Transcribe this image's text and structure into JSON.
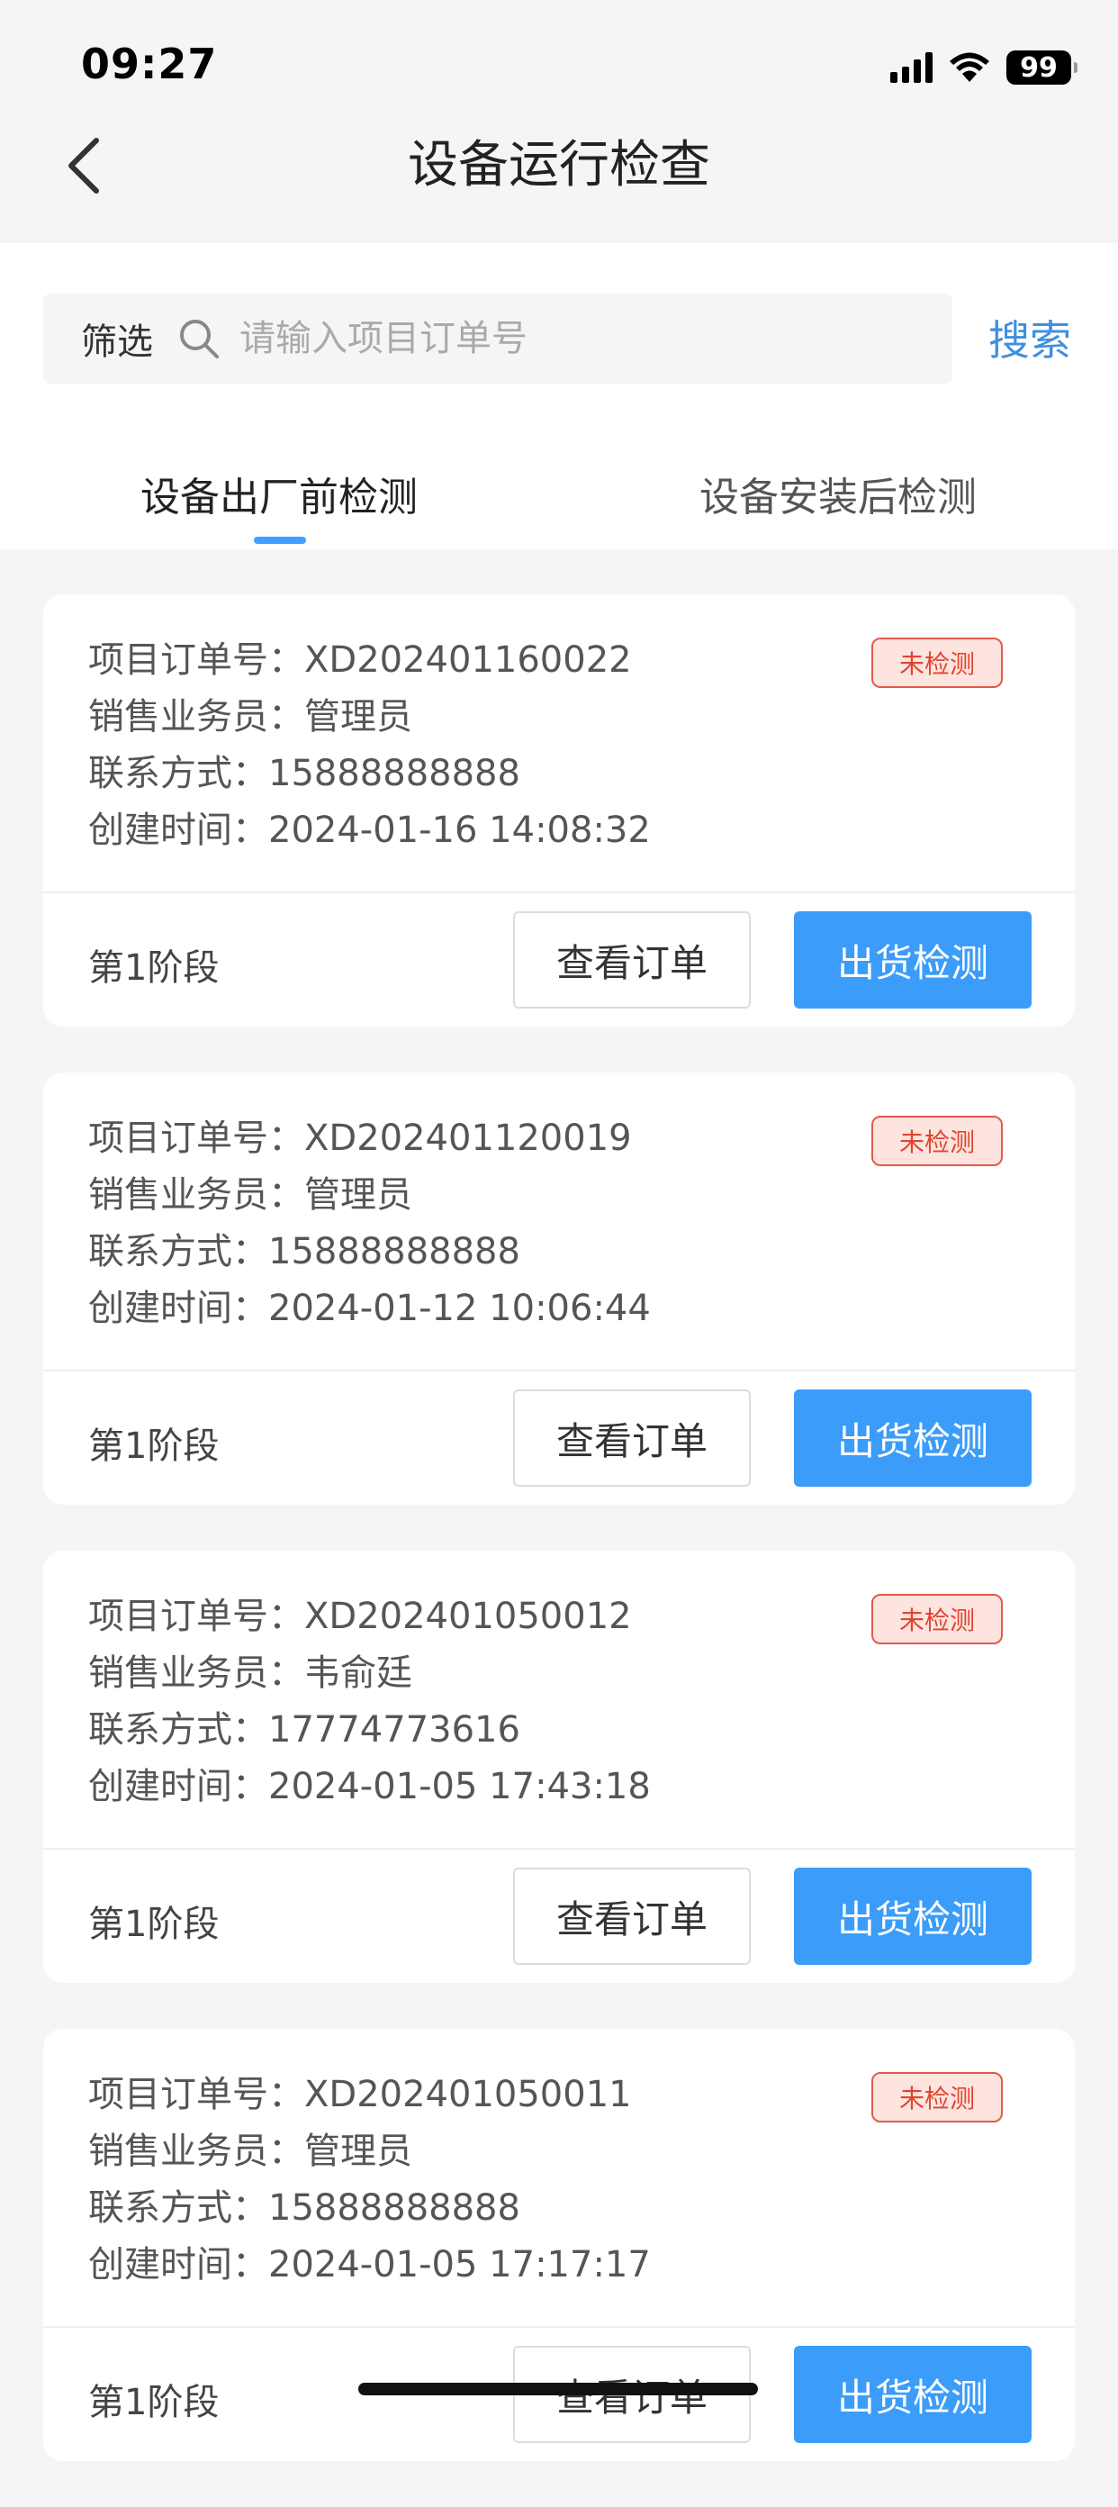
{
  "status_bar": {
    "time": "09:27",
    "battery": "99",
    "icons": [
      "cellular-signal-icon",
      "wifi-icon",
      "battery-icon"
    ]
  },
  "nav": {
    "title": "设备运行检查",
    "back_icon": "chevron-left-icon"
  },
  "search": {
    "filter_label": "筛选",
    "placeholder": "请输入项目订单号",
    "value": "",
    "button": "搜索"
  },
  "tabs": [
    {
      "label": "设备出厂前检测",
      "active": true
    },
    {
      "label": "设备安装后检测",
      "active": false
    }
  ],
  "colors": {
    "accent": "#3b9cf9",
    "search_link": "#3e90e0",
    "badge_red": "#e0442f",
    "badge_bg": "#fde4df"
  },
  "orders": [
    {
      "order_no": "项目订单号：XD202401160022",
      "salesperson": "销售业务员：管理员",
      "contact": "联系方式：15888888888",
      "created": "创建时间：2024-01-16 14:08:32",
      "status": "未检测",
      "stage": "第1阶段",
      "view_label": "查看订单",
      "check_label": "出货检测"
    },
    {
      "order_no": "项目订单号：XD202401120019",
      "salesperson": "销售业务员：管理员",
      "contact": "联系方式：15888888888",
      "created": "创建时间：2024-01-12 10:06:44",
      "status": "未检测",
      "stage": "第1阶段",
      "view_label": "查看订单",
      "check_label": "出货检测"
    },
    {
      "order_no": "项目订单号：XD202401050012",
      "salesperson": "销售业务员：韦俞廷",
      "contact": "联系方式：17774773616",
      "created": "创建时间：2024-01-05 17:43:18",
      "status": "未检测",
      "stage": "第1阶段",
      "view_label": "查看订单",
      "check_label": "出货检测"
    },
    {
      "order_no": "项目订单号：XD202401050011",
      "salesperson": "销售业务员：管理员",
      "contact": "联系方式：15888888888",
      "created": "创建时间：2024-01-05 17:17:17",
      "status": "未检测",
      "stage": "第1阶段",
      "view_label": "查看订单",
      "check_label": "出货检测"
    }
  ]
}
